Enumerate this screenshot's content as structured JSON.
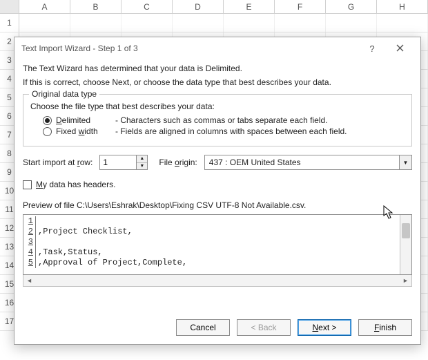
{
  "sheet": {
    "columns": [
      "A",
      "B",
      "C",
      "D",
      "E",
      "F",
      "G",
      "H"
    ],
    "rows": [
      "1",
      "2",
      "3",
      "4",
      "5",
      "6",
      "7",
      "8",
      "9",
      "10",
      "11",
      "12",
      "13",
      "14",
      "15",
      "16",
      "17"
    ]
  },
  "dialog": {
    "title": "Text Import Wizard - Step 1 of 3",
    "help_label": "?",
    "intro1": "The Text Wizard has determined that your data is Delimited.",
    "intro2": "If this is correct, choose Next, or choose the data type that best describes your data.",
    "group": {
      "legend": "Original data type",
      "sub": "Choose the file type that best describes your data:",
      "options": [
        {
          "pre": "",
          "ak": "D",
          "post": "elimited",
          "desc": "- Characters such as commas or tabs separate each field.",
          "checked": true
        },
        {
          "pre": "Fixed ",
          "ak": "w",
          "post": "idth",
          "desc": "- Fields are aligned in columns with spaces between each field.",
          "checked": false
        }
      ]
    },
    "start_row": {
      "label_pre": "Start import at ",
      "label_ak": "r",
      "label_post": "ow:",
      "value": "1"
    },
    "file_origin": {
      "label_pre": "File ",
      "label_ak": "o",
      "label_post": "rigin:",
      "value": "437 : OEM United States"
    },
    "headers_chk": {
      "pre": "",
      "ak": "M",
      "post": "y data has headers.",
      "checked": false
    },
    "preview_label": "Preview of file C:\\Users\\Eshrak\\Desktop\\Fixing CSV UTF-8 Not Available.csv.",
    "preview_lines": [
      {
        "n": "1",
        "text": ""
      },
      {
        "n": "2",
        "text": ",Project Checklist,"
      },
      {
        "n": "3",
        "text": ""
      },
      {
        "n": "4",
        "text": ",Task,Status,"
      },
      {
        "n": "5",
        "text": ",Approval of Project,Complete,"
      }
    ],
    "buttons": {
      "cancel": "Cancel",
      "back": "< Back",
      "next_ak": "N",
      "next_post": "ext >",
      "finish_ak": "F",
      "finish_post": "inish"
    }
  }
}
